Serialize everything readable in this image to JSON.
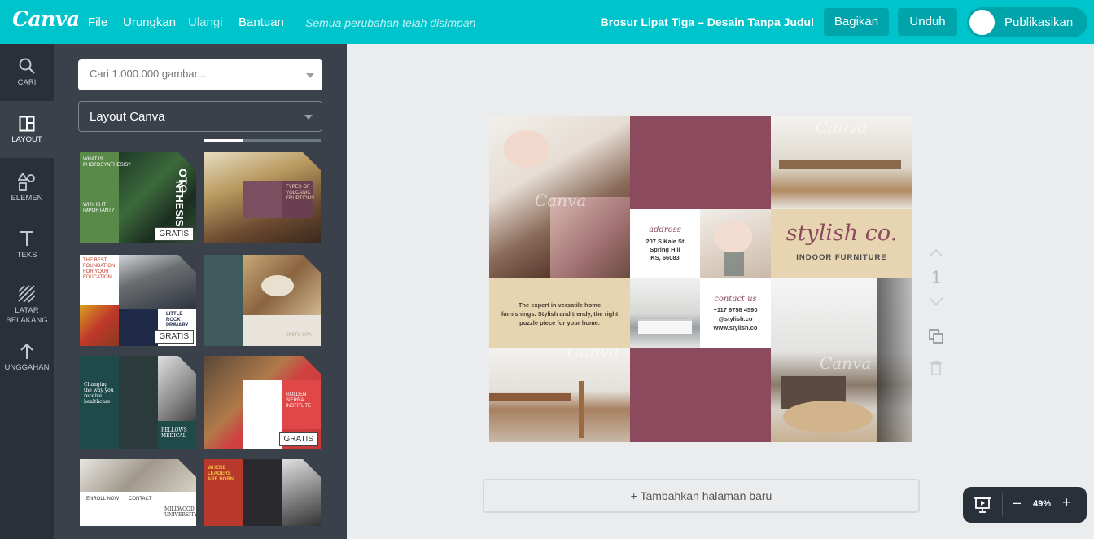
{
  "app": {
    "logo": "Canva",
    "doc_title": "Brosur Lipat Tiga – Desain Tanpa Judul",
    "saved_status": "Semua perubahan telah disimpan"
  },
  "menu": {
    "file": "File",
    "undo": "Urungkan",
    "redo": "Ulangi",
    "help": "Bantuan"
  },
  "actions": {
    "share": "Bagikan",
    "download": "Unduh",
    "publish": "Publikasikan"
  },
  "rail": {
    "search": "CARI",
    "layout": "LAYOUT",
    "elements": "ELEMEN",
    "text": "TEKS",
    "background_1": "LATAR",
    "background_2": "BELAKANG",
    "uploads": "UNGGAHAN"
  },
  "panel": {
    "search_placeholder": "Cari 1.000.000 gambar...",
    "layout_select": "Layout Canva",
    "badge": "GRATIS",
    "templates": [
      {
        "text_1": "OTO",
        "text_2": "NTHESIS",
        "text_3": "WHAT IS PHOTOSYNTHESIS?",
        "text_4": "WHY IS IT IMPORTANT?"
      },
      {
        "text_1": "TYPES OF VOLCANIC ERUPTIONS"
      },
      {
        "text_1": "THE BEST FOUNDATION FOR YOUR EDUCATION",
        "text_2": "LITTLE ROCK PRIMARY"
      },
      {
        "text_1": "SMITH SPA"
      },
      {
        "text_1": "Changing the way you receive healthcare",
        "text_2": "FELLOWS MEDICAL"
      },
      {
        "text_1": "GOLDEN SIERRA INSTITUTE"
      },
      {
        "text_1": "ENROLL NOW",
        "text_2": "CONTACT",
        "text_3": "MILLWOOD UNIVERSITY"
      },
      {
        "text_1": "WHERE LEADERS ARE BORN"
      }
    ]
  },
  "canvas": {
    "address_title": "address",
    "address_1": "207 S Kale St",
    "address_2": "Spring Hill",
    "address_3": "KS, 66083",
    "brand": "stylish co.",
    "brand_sub": "INDOOR FURNITURE",
    "tagline": "The expert in versatile home furnishings. Stylish and trendy, the right puzzle piece for your home.",
    "contact_title": "contact us",
    "contact_1": "+117 6758 4590",
    "contact_2": "@stylish.co",
    "contact_3": "www.stylish.co",
    "watermark": "Canva"
  },
  "page_number": "1",
  "add_page": "+ Tambahkan halaman baru",
  "zoom": {
    "minus": "–",
    "level": "49%",
    "plus": "+"
  },
  "colors": {
    "topbar": "#00c4cc",
    "button": "#00a5ab",
    "rail": "#293039",
    "panel": "#3a414b",
    "mauve": "#8c4a5f",
    "beige": "#e6d5b0"
  }
}
